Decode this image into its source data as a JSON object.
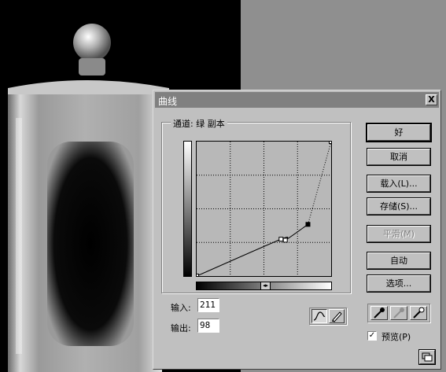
{
  "dialog": {
    "title": "曲线",
    "close_glyph": "X",
    "channel_label": "通道: 绿 副本",
    "input_label": "输入:",
    "input_value": "211",
    "output_label": "输出:",
    "output_value": "98",
    "preview_label": "预览(P)",
    "preview_checked": true,
    "buttons": {
      "ok": "好",
      "cancel": "取消",
      "load": "载入(L)...",
      "save": "存储(S)...",
      "smooth": "平滑(M)",
      "auto": "自动",
      "options": "选项..."
    }
  },
  "curve": {
    "control_points": [
      [
        0,
        0
      ],
      [
        160,
        70
      ],
      [
        168,
        68
      ],
      [
        211,
        98
      ],
      [
        255,
        255
      ]
    ],
    "selected_point": [
      211,
      98
    ]
  },
  "icons": {
    "curve_tool": "curve-tool-icon",
    "pencil_tool": "pencil-icon",
    "black_eyedropper": "black-eyedropper-icon",
    "gray_eyedropper": "gray-eyedropper-icon",
    "white_eyedropper": "white-eyedropper-icon",
    "resize": "resize-icon",
    "gradient_toggle": "gradient-toggle-icon"
  },
  "colors": {
    "dialog_face": "#c0c0c0",
    "titlebar": "#808080",
    "background_panel": "#8f8f8f"
  }
}
